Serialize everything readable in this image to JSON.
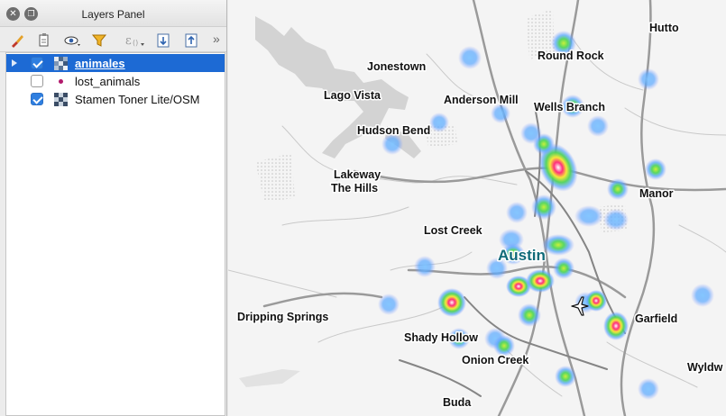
{
  "panel": {
    "title": "Layers Panel",
    "close_icon": "close-icon",
    "float_icon": "float-icon",
    "more_glyph": "»"
  },
  "toolbar": {
    "tools": [
      {
        "name": "style-brush-icon"
      },
      {
        "name": "add-group-icon"
      },
      {
        "name": "visibility-eye-icon"
      },
      {
        "name": "filter-icon"
      },
      {
        "name": "expression-filter-icon"
      },
      {
        "name": "expand-all-icon"
      },
      {
        "name": "collapse-all-icon"
      }
    ]
  },
  "layers": [
    {
      "label": "animales",
      "checked": true,
      "selected": true,
      "icon": "heatmap-raster-icon"
    },
    {
      "label": "lost_animals",
      "checked": false,
      "selected": false,
      "icon": "point-layer-icon"
    },
    {
      "label": "Stamen Toner Lite/OSM",
      "checked": true,
      "selected": false,
      "icon": "tile-layer-icon"
    }
  ],
  "map": {
    "places": [
      "Hutto",
      "Round Rock",
      "Jonestown",
      "Lago Vista",
      "Anderson Mill",
      "Wells Branch",
      "Hudson Bend",
      "Lakeway",
      "The Hills",
      "Manor",
      "Lost Creek",
      "Austin",
      "Dripping Springs",
      "Garfield",
      "Shady Hollow",
      "Onion Creek",
      "Wyldw",
      "Buda"
    ],
    "airport_icon": "airport-icon",
    "colors": {
      "heat_low": "#5aa8ff",
      "heat_mid": "#7ddc3a",
      "heat_high": "#ff2f7a",
      "road": "#8f8f8f",
      "water": "#d2d2d2"
    }
  }
}
